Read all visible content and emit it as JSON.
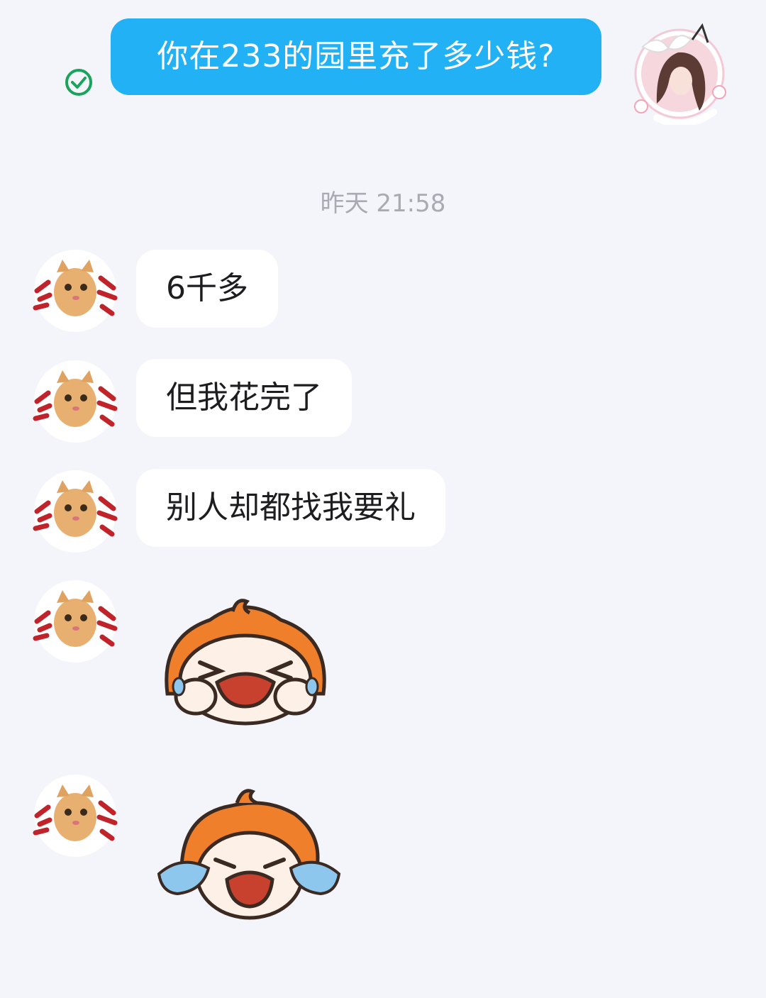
{
  "sent_message": {
    "text": "你在233的园里充了多少钱?",
    "status_icon": "read-check-icon"
  },
  "my_avatar": "cat-ear-girl-avatar",
  "timestamp": "昨天 21:58",
  "contact_avatar": "orange-cat-avatar",
  "received_messages": [
    {
      "type": "text",
      "text": "6千多"
    },
    {
      "type": "text",
      "text": "但我花完了"
    },
    {
      "type": "text",
      "text": "别人却都找我要礼"
    },
    {
      "type": "sticker",
      "sticker": "crying-orange-character-sticker"
    },
    {
      "type": "sticker",
      "sticker": "wailing-orange-character-sticker"
    }
  ],
  "colors": {
    "background": "#f4f5fa",
    "sent_bubble": "#22b1f5",
    "received_bubble": "#ffffff",
    "read_check": "#1aa35a",
    "sticker_orange": "#f07f2b"
  }
}
